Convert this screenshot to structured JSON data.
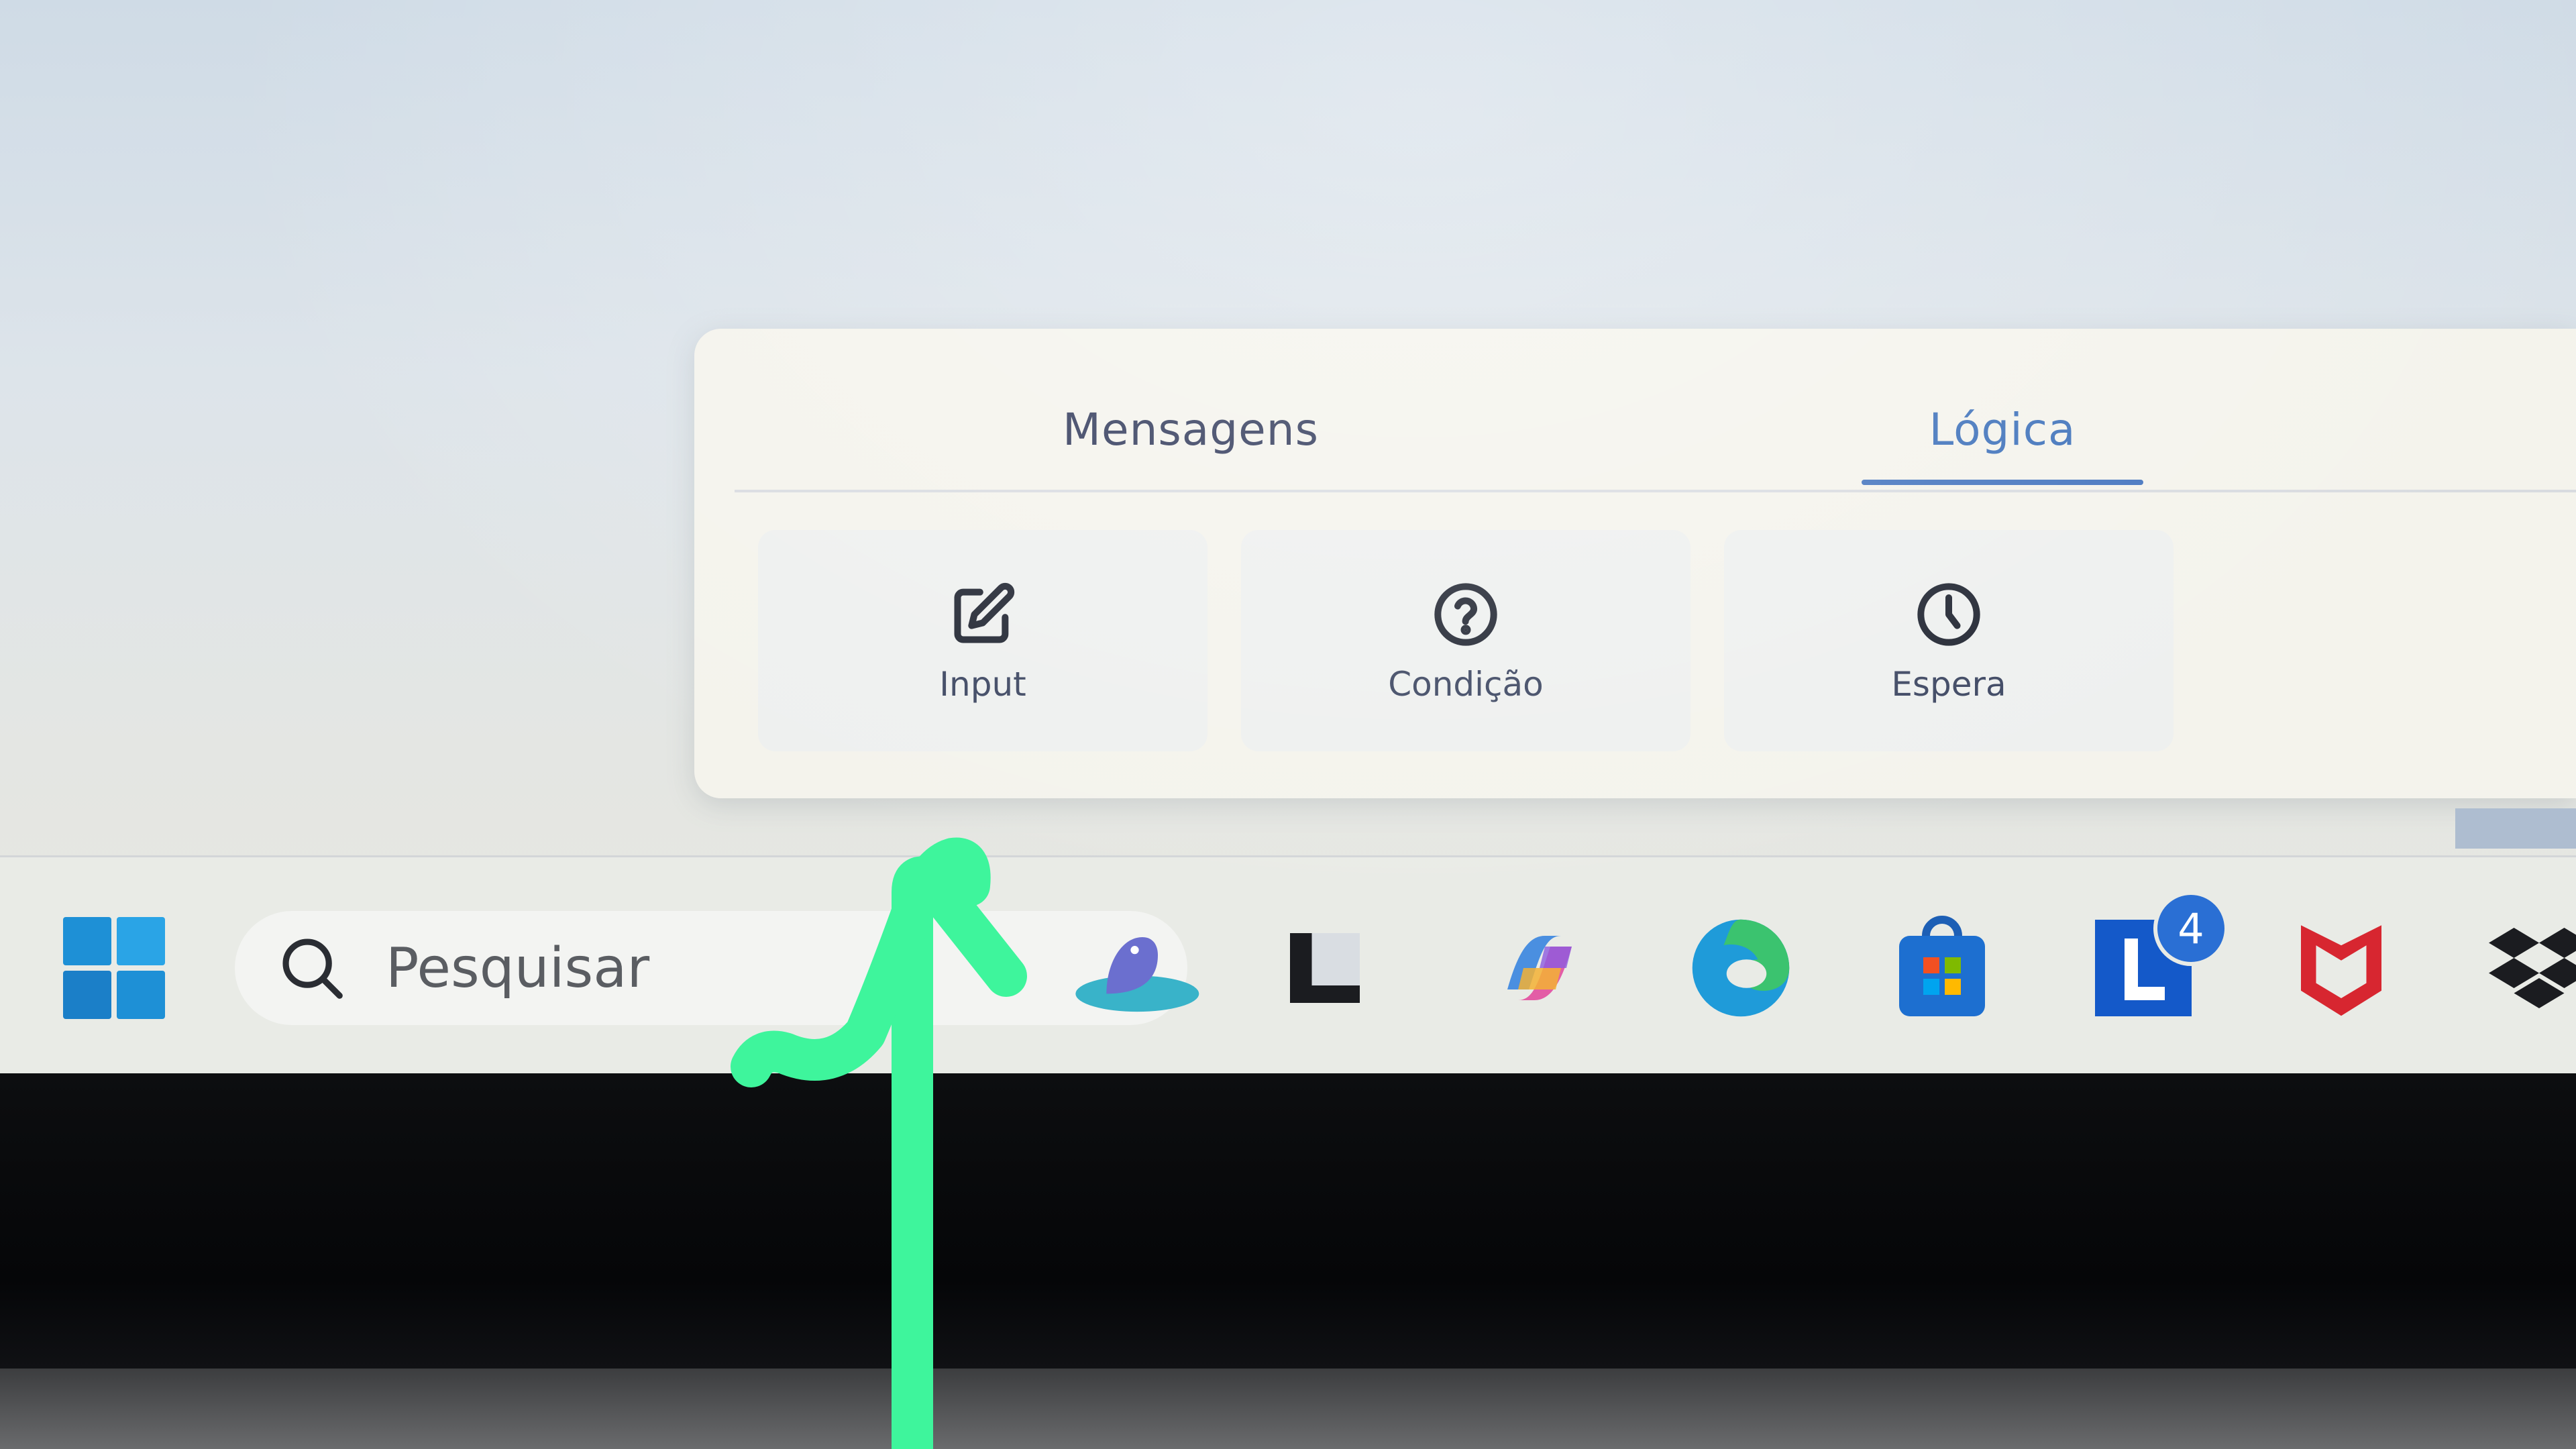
{
  "panel": {
    "tabs": [
      {
        "label": "Mensagens",
        "active": false
      },
      {
        "label": "Lógica",
        "active": true
      }
    ],
    "blocks": [
      {
        "label": "Input",
        "icon": "edit-icon"
      },
      {
        "label": "Condição",
        "icon": "question-circle-icon"
      },
      {
        "label": "Espera",
        "icon": "clock-icon"
      }
    ]
  },
  "taskbar": {
    "search_placeholder": "Pesquisar",
    "apps": [
      {
        "name": "widgets",
        "icon": "widgets-weather-icon"
      },
      {
        "name": "files",
        "icon": "file-app-icon"
      },
      {
        "name": "copilot",
        "icon": "copilot-icon"
      },
      {
        "name": "edge",
        "icon": "edge-icon"
      },
      {
        "name": "store",
        "icon": "store-icon"
      },
      {
        "name": "l-app",
        "icon": "l-app-icon",
        "badge": "4"
      },
      {
        "name": "mcafee",
        "icon": "mcafee-icon"
      },
      {
        "name": "dropbox",
        "icon": "dropbox-icon"
      }
    ]
  },
  "colors": {
    "accent_tab": "#3b6fb9",
    "annotation_arrow": "#3ef59c",
    "windows_blue": "#1e90d6"
  }
}
